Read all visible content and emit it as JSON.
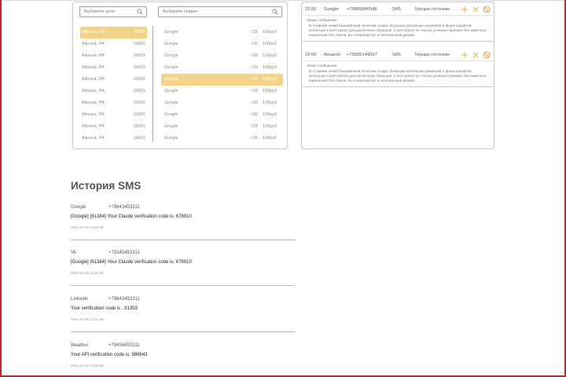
{
  "selector": {
    "state_search_placeholder": "Выберите штат",
    "service_search_placeholder": "Выберите сервис",
    "states": [
      {
        "name": "Altoona, PA",
        "code": "16601",
        "selected": true
      },
      {
        "name": "Altoona, PA",
        "code": "16601",
        "selected": false
      },
      {
        "name": "Altoona, PA",
        "code": "16601",
        "selected": false
      },
      {
        "name": "Altoona, PA",
        "code": "16601",
        "selected": false
      },
      {
        "name": "Altoona, PA",
        "code": "16601",
        "selected": false
      },
      {
        "name": "Altoona, PA",
        "code": "16601",
        "selected": false
      },
      {
        "name": "Altoona, PA",
        "code": "16601",
        "selected": false
      },
      {
        "name": "Altoona, PA",
        "code": "16601",
        "selected": false
      },
      {
        "name": "Altoona, PA",
        "code": "16601",
        "selected": false
      },
      {
        "name": "Altoona, PA",
        "code": "16601",
        "selected": false
      }
    ],
    "services": [
      {
        "name": "Google",
        "count": "~130",
        "price": "100руб",
        "selected": false
      },
      {
        "name": "Google",
        "count": "~130",
        "price": "100руб",
        "selected": false
      },
      {
        "name": "Google",
        "count": "~130",
        "price": "100руб",
        "selected": false
      },
      {
        "name": "Google",
        "count": "~130",
        "price": "100руб",
        "selected": false
      },
      {
        "name": "Google",
        "count": "~130",
        "price": "100руб",
        "selected": true
      },
      {
        "name": "Google",
        "count": "~130",
        "price": "100руб",
        "selected": false
      },
      {
        "name": "Google",
        "count": "~130",
        "price": "100руб",
        "selected": false
      },
      {
        "name": "Google",
        "count": "~130",
        "price": "100руб",
        "selected": false
      },
      {
        "name": "Google",
        "count": "~130",
        "price": "100руб",
        "selected": false
      },
      {
        "name": "Google",
        "count": "~130",
        "price": "100руб",
        "selected": false
      }
    ]
  },
  "numbers": [
    {
      "time": "15:00",
      "service": "Google",
      "phone": "+79895840546",
      "type": "SMS",
      "state": "Текущее состояние",
      "message_label": "Ваше сообщение:",
      "message": "В то время некий безымянный печатник создал большую коллекцию размеров и форм шрифтов, используя Lorem Ipsum для распечатки образцов. Lorem Ipsum не только успешно пережил без заметных изменений пять веков, но и перешагнул в электронный дизайн."
    },
    {
      "time": "15:00",
      "service": "Amazon",
      "phone": "+79995149067",
      "type": "SMS",
      "state": "Текущее состояние",
      "message_label": "Ваше сообщение:",
      "message": "В то время некий безымянный печатник создал большую коллекцию размеров и форм шрифтов, используя Lorem Ipsum для распечатки образцов. Lorem Ipsum не только успешно пережил без заметных изменений пять веков, но и перешагнул в электронный дизайн."
    }
  ],
  "colors": {
    "accent": "#f2d389",
    "icon_accent": "#e8b04a",
    "frame_red": "#c0262c"
  },
  "icons": [
    "search-icon",
    "plus-icon",
    "close-icon",
    "block-icon"
  ],
  "history": {
    "title": "История SMS",
    "entries": [
      {
        "service": "Google",
        "phone": "+79643453311",
        "text": "[Google] {61384} Your Claude verification code is: 678910",
        "timestamp": "2023-10-25 12:31:36"
      },
      {
        "service": "Vk",
        "phone": "+79345453311",
        "text": "[Google] {61384} Your Claude verification code is: 678910",
        "timestamp": "2023-10-25 12:31:36"
      },
      {
        "service": "Linkedin",
        "phone": "+79643453311",
        "text": "Your verification code is : 81359",
        "timestamp": "2023-10-25 12:31:36"
      },
      {
        "service": "Weather",
        "phone": "+79456653311",
        "text": "Your API verification code is: 988643",
        "timestamp": "2023-10-25 12:31:36"
      }
    ]
  }
}
